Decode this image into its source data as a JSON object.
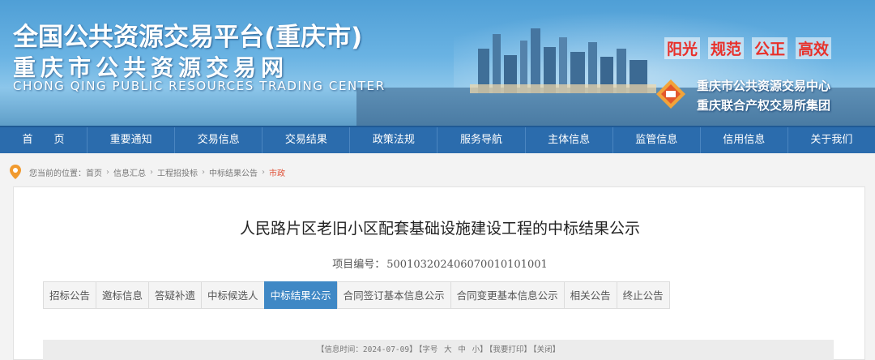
{
  "header": {
    "title_cn": "全国公共资源交易平台(重庆市)",
    "subtitle_cn": "重庆市公共资源交易网",
    "title_en": "CHONG QING PUBLIC RESOURCES TRADING CENTER",
    "slogans": [
      "阳光",
      "规范",
      "公正",
      "高效"
    ],
    "org_line1": "重庆市公共资源交易中心",
    "org_line2": "重庆联合产权交易所集团"
  },
  "nav": {
    "items": [
      {
        "label": "首　　页"
      },
      {
        "label": "重要通知"
      },
      {
        "label": "交易信息"
      },
      {
        "label": "交易结果"
      },
      {
        "label": "政策法规"
      },
      {
        "label": "服务导航"
      },
      {
        "label": "主体信息"
      },
      {
        "label": "监管信息"
      },
      {
        "label": "信用信息"
      },
      {
        "label": "关于我们"
      }
    ]
  },
  "breadcrumb": {
    "prefix": "您当前的位置：",
    "items": [
      "首页",
      "信息汇总",
      "工程招投标",
      "中标结果公告",
      "市政"
    ],
    "separator": "›"
  },
  "article": {
    "title": "人民路片区老旧小区配套基础设施建设工程的中标结果公示",
    "project_no_label": "项目编号：",
    "project_no_value": "500103202406070010101001"
  },
  "tabs": [
    {
      "label": "招标公告",
      "active": false
    },
    {
      "label": "邀标信息",
      "active": false
    },
    {
      "label": "答疑补遗",
      "active": false
    },
    {
      "label": "中标候选人",
      "active": false
    },
    {
      "label": "中标结果公示",
      "active": true
    },
    {
      "label": "合同签订基本信息公示",
      "active": false
    },
    {
      "label": "合同变更基本信息公示",
      "active": false
    },
    {
      "label": "相关公告",
      "active": false
    },
    {
      "label": "终止公告",
      "active": false
    }
  ],
  "info_bar": {
    "info_time": "【信息时间：2024-07-09】",
    "font_size": "【字号",
    "size_large": "大",
    "size_medium": "中",
    "size_small": "小】",
    "print": "【我要打印】",
    "close": "【关闭】"
  },
  "colors": {
    "nav_bg": "#2b6cad",
    "tab_active": "#3f88c5",
    "slogan_red": "#e8312b",
    "breadcrumb_current": "#e0533a"
  },
  "icons": {
    "breadcrumb": "location-pin-icon",
    "logo": "exchange-logo-icon"
  }
}
